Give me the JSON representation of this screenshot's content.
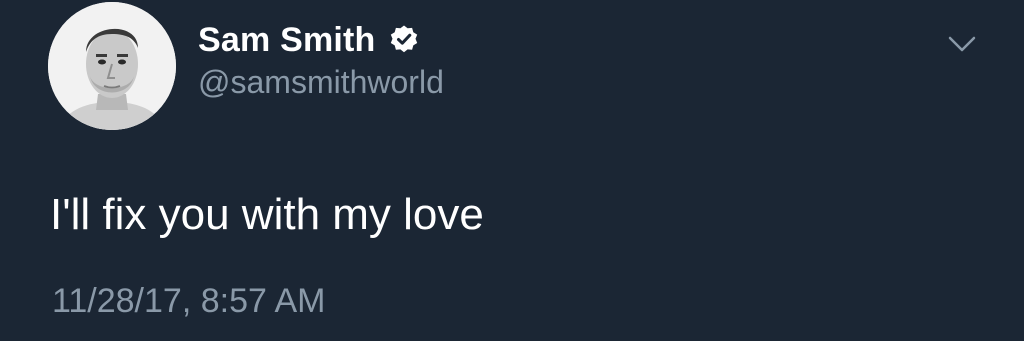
{
  "tweet": {
    "author": {
      "display_name": "Sam Smith",
      "handle": "@samsmithworld",
      "verified": true,
      "avatar_icon": "profile-photo"
    },
    "text": "I'll fix you with my love",
    "timestamp": "11/28/17, 8:57 AM",
    "menu_icon": "chevron-down-icon"
  },
  "colors": {
    "background": "#1b2634",
    "primary_text": "#ffffff",
    "secondary_text": "#8a99a8",
    "verified_badge": "#ffffff",
    "chevron": "#8a99a8"
  }
}
